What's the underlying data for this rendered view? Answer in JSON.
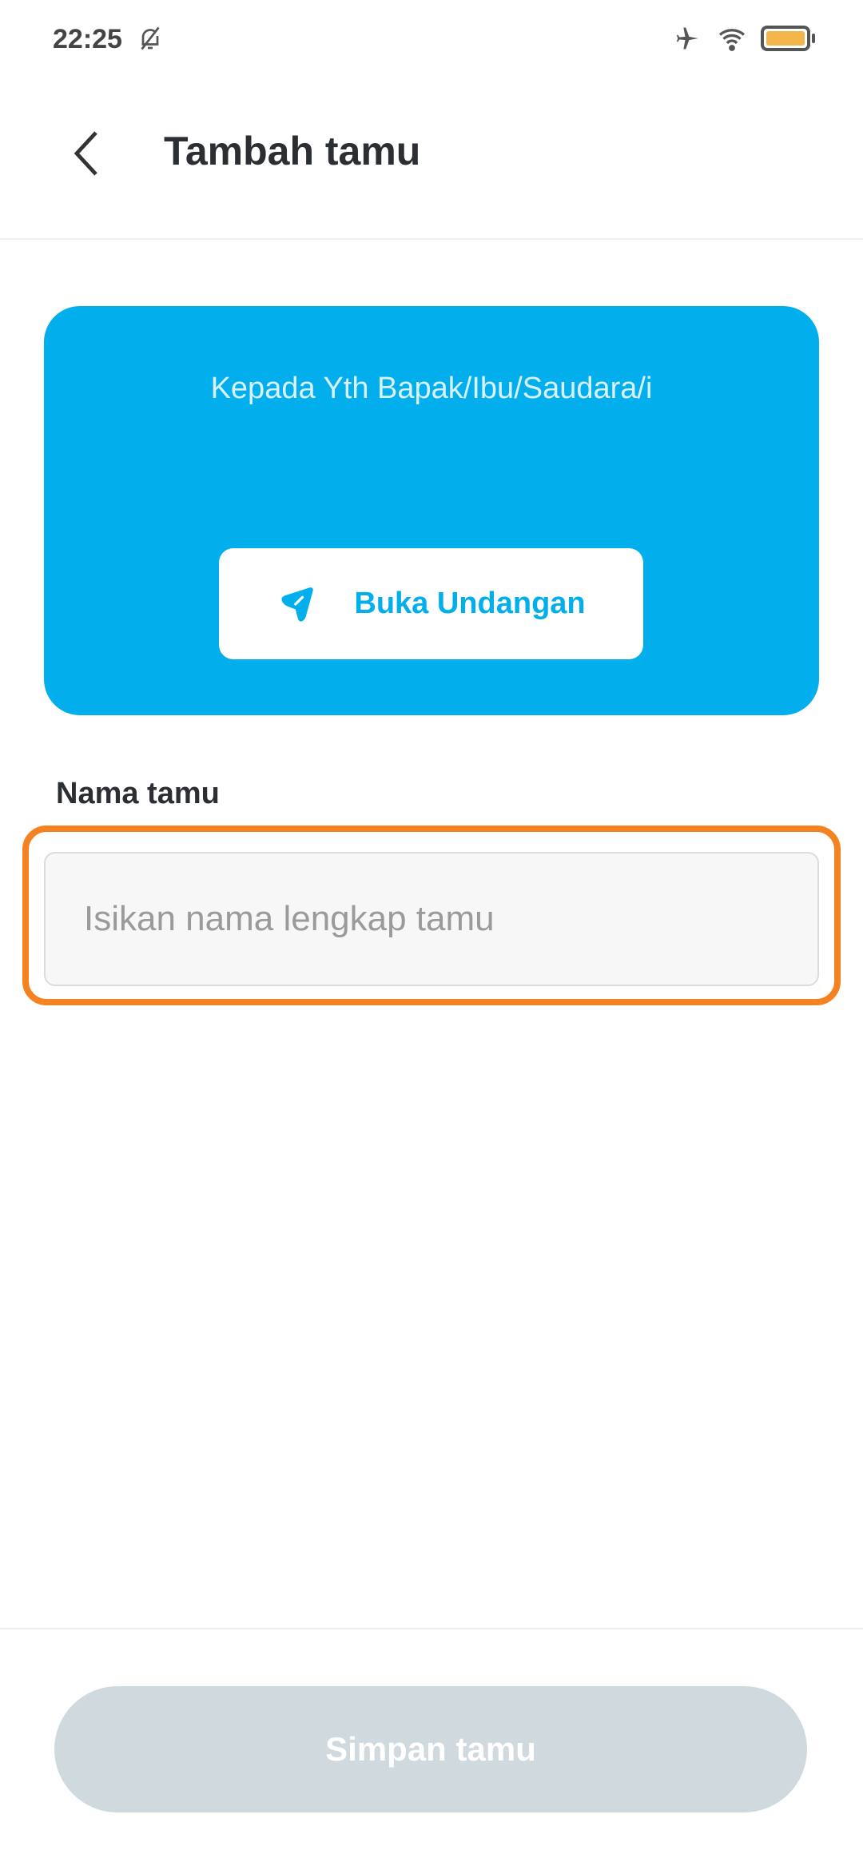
{
  "status_bar": {
    "time": "22:25",
    "icons": [
      "bell-off-icon",
      "airplane-icon",
      "wifi-icon",
      "battery-icon"
    ],
    "battery_color": "#F2B64A"
  },
  "header": {
    "title": "Tambah tamu",
    "back_icon": "chevron-left-icon"
  },
  "card": {
    "greeting": "Kepada Yth Bapak/Ibu/Saudara/i",
    "open_button": "Buka Undangan",
    "open_icon": "send-icon",
    "color": "#03AEEC"
  },
  "form": {
    "label": "Nama tamu",
    "placeholder": "Isikan nama lengkap tamu",
    "value": "",
    "highlight_color": "#F58220"
  },
  "footer": {
    "save_button": "Simpan tamu"
  }
}
